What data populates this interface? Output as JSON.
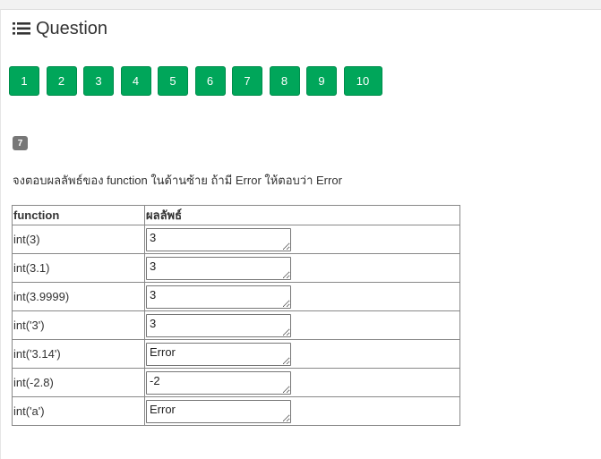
{
  "header": {
    "title": "Question",
    "icon": "list-icon"
  },
  "question_buttons": [
    "1",
    "2",
    "3",
    "4",
    "5",
    "6",
    "7",
    "8",
    "9",
    "10"
  ],
  "question": {
    "number": "7",
    "instruction": "จงตอบผลลัพธ์ของ function ในด้านซ้าย ถ้ามี Error ให้ตอบว่า Error"
  },
  "table": {
    "headers": [
      "function",
      "ผลลัพธ์"
    ],
    "rows": [
      {
        "function": "int(3)",
        "answer": "3"
      },
      {
        "function": "int(3.1)",
        "answer": "3"
      },
      {
        "function": "int(3.9999)",
        "answer": "3"
      },
      {
        "function": "int('3')",
        "answer": "3"
      },
      {
        "function": "int('3.14')",
        "answer": "Error"
      },
      {
        "function": "int(-2.8)",
        "answer": "-2"
      },
      {
        "function": "int('a')",
        "answer": "Error"
      }
    ]
  },
  "colors": {
    "button": "#00a65a",
    "badge": "#777777"
  }
}
